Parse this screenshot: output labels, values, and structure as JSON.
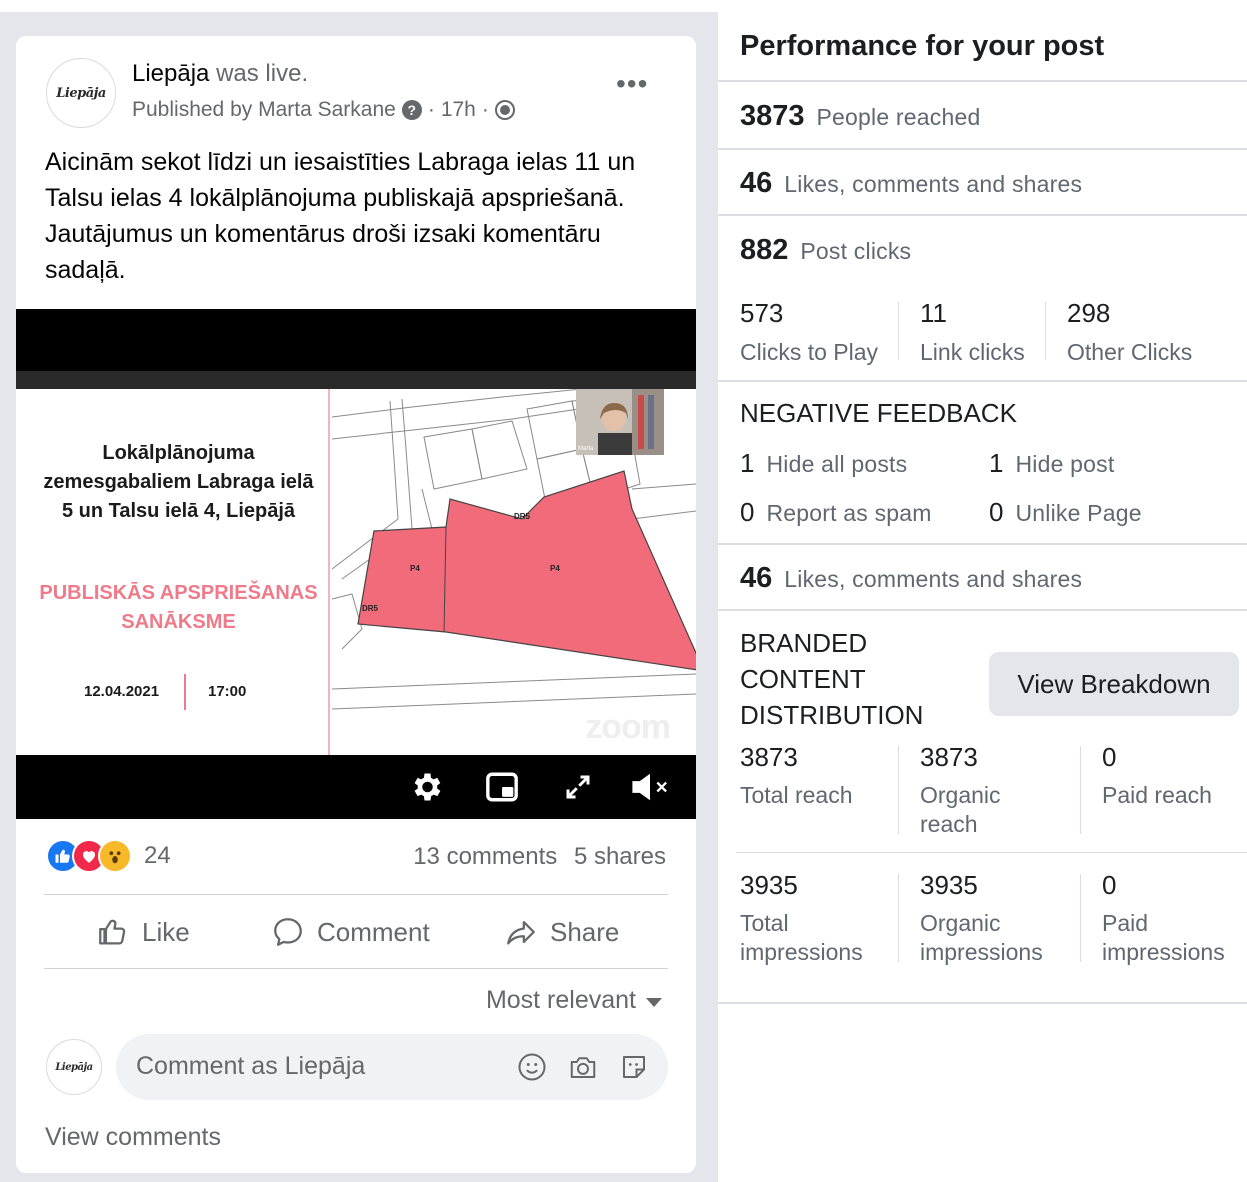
{
  "post": {
    "logo_text": "Liepāja",
    "page_name": "Liepāja",
    "live_text": "was live.",
    "published_by": "Published by Marta Sarkane",
    "time": "17h",
    "body": "Aicinām sekot līdzi un iesaistīties Labraga ielas 11 un Talsu ielas 4 lokālplānojuma publiskajā apspriešanā. Jautājumus un komentārus droši izsaki komentāru sadaļā.",
    "video": {
      "slide_title": "Lokālplānojuma zemesgabaliem Labraga ielā 5 un Talsu ielā 4, Liepājā",
      "slide_subtitle": "PUBLISKĀS APSPRIEŠANAS SANĀKSME",
      "slide_date": "12.04.2021",
      "slide_time": "17:00",
      "webcam_label": "Marta",
      "watermark": "zoom",
      "map_labels": [
        "P4",
        "P4",
        "DR5",
        "DR5"
      ]
    },
    "reaction_icons": [
      "like-icon",
      "love-icon",
      "wow-icon"
    ],
    "reaction_count": "24",
    "comments": "13 comments",
    "shares": "5 shares",
    "actions": {
      "like": "Like",
      "comment": "Comment",
      "share": "Share"
    },
    "sort_label": "Most relevant",
    "comment_placeholder": "Comment as Liepāja",
    "view_comments": "View comments",
    "colors": {
      "accent": "#1877f2",
      "slide_accent": "#ef7a89",
      "map_fill": "#f26b7a"
    }
  },
  "performance": {
    "title": "Performance for your post",
    "people_reached": {
      "value": "3873",
      "label": "People reached"
    },
    "engagement": {
      "value": "46",
      "label": "Likes, comments and shares"
    },
    "post_clicks": {
      "value": "882",
      "label": "Post clicks"
    },
    "clicks_breakdown": [
      {
        "value": "573",
        "label": "Clicks to Play"
      },
      {
        "value": "11",
        "label": "Link clicks"
      },
      {
        "value": "298",
        "label": "Other Clicks"
      }
    ],
    "negative_feedback": {
      "title": "NEGATIVE FEEDBACK",
      "items": [
        {
          "value": "1",
          "label": "Hide all posts"
        },
        {
          "value": "1",
          "label": "Hide post"
        },
        {
          "value": "0",
          "label": "Report as spam"
        },
        {
          "value": "0",
          "label": "Unlike Page"
        }
      ]
    },
    "engagement2": {
      "value": "46",
      "label": "Likes, comments and shares"
    },
    "branded": {
      "title_lines": [
        "BRANDED",
        "CONTENT",
        "DISTRIBUTION"
      ],
      "button": "View Breakdown",
      "reach": [
        {
          "value": "3873",
          "label_lines": [
            "Total reach"
          ]
        },
        {
          "value": "3873",
          "label_lines": [
            "Organic",
            "reach"
          ]
        },
        {
          "value": "0",
          "label_lines": [
            "Paid reach"
          ]
        }
      ],
      "impressions": [
        {
          "value": "3935",
          "label_lines": [
            "Total",
            "impressions"
          ]
        },
        {
          "value": "3935",
          "label_lines": [
            "Organic",
            "impressions"
          ]
        },
        {
          "value": "0",
          "label_lines": [
            "Paid",
            "impressions"
          ]
        }
      ]
    }
  }
}
